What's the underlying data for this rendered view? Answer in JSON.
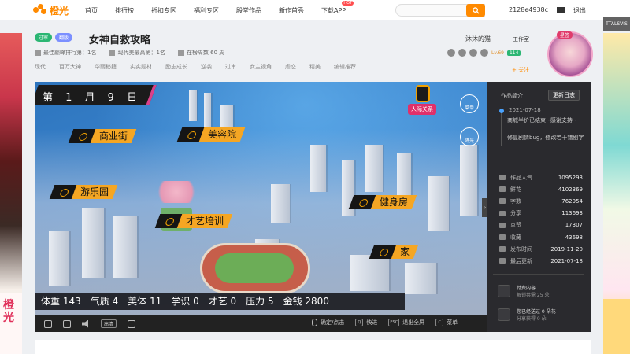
{
  "header": {
    "logo_text": "橙光",
    "nav": [
      "首页",
      "排行榜",
      "折扣专区",
      "福利专区",
      "殿堂作品",
      "新作首秀",
      "下载APP"
    ],
    "nav_hot": "HOT",
    "search_placeholder": "",
    "user_id": "2128e4938c",
    "logout": "退出"
  },
  "side_ads": {
    "corner_text": "TTALSVIS",
    "left_bottom": "橙光"
  },
  "work": {
    "tags": [
      "过审",
      "翻版"
    ],
    "title": "女神自救攻略",
    "meta": [
      "最佳巅峰排行第：1名",
      "现代美最高第：1名",
      "在榜周数 60 周"
    ],
    "genres": [
      "现代",
      "百万大神",
      "华丽秘籍",
      "实实题材",
      "励志成长",
      "逆袭",
      "过审",
      "女主视角",
      "虐恋",
      "精美",
      "编辑推荐"
    ],
    "author": "沐沐的猫",
    "workroom": "工作室",
    "level": "Lv.69",
    "level2": "114",
    "avatar_tag": "星签",
    "follow": "+ 关注"
  },
  "game": {
    "date": "第 1 月 9 日",
    "relation_btn": "人际关系",
    "menu_btn": "菜单",
    "brightness_btn": "降光",
    "locations": [
      "商业街",
      "美容院",
      "游乐园",
      "才艺培训",
      "健身房",
      "家"
    ],
    "stats": "体重 143　气质 4　美体 11　学识 0　才艺 0　压力 5　金钱 2800"
  },
  "controls": {
    "hd": "高清",
    "confirm": "确定/点击",
    "fast": "快进",
    "exit_full": "退出全屏",
    "menu": "菜单",
    "keys": [
      "Q",
      "ESC",
      "C"
    ]
  },
  "panel": {
    "header": "作品简介",
    "update_btn": "更新日志",
    "date": "2021-07-18",
    "notes": [
      "商城半价已结束~感谢支持~",
      "修复剧情bug，修改若干错别字"
    ],
    "stats": [
      {
        "k": "作品人气",
        "v": "1095293"
      },
      {
        "k": "鲜花",
        "v": "4102369"
      },
      {
        "k": "字数",
        "v": "762954"
      },
      {
        "k": "分享",
        "v": "113693"
      },
      {
        "k": "点赞",
        "v": "17307"
      },
      {
        "k": "收藏",
        "v": "43698"
      },
      {
        "k": "发布时间",
        "v": "2019-11-20"
      },
      {
        "k": "最后更新",
        "v": "2021-07-18"
      }
    ],
    "paid": {
      "title": "付费内容",
      "sub": "解锁共需 25 朵"
    },
    "share": {
      "title": "您已经送过 0 朵花",
      "sub": "分享获得 0 朵"
    }
  }
}
